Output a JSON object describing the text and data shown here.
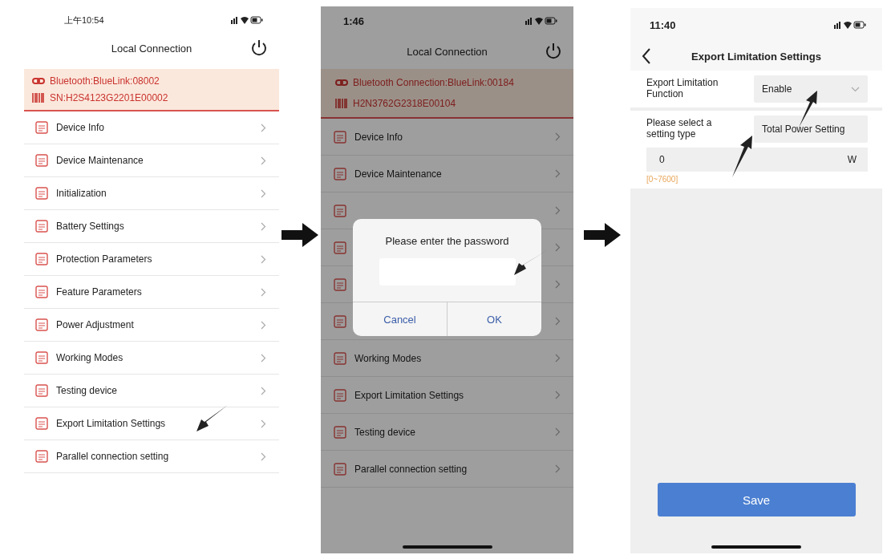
{
  "screens": [
    {
      "kind": "menu",
      "status_bar": {
        "time": "上午10:54"
      },
      "title": "Local Connection",
      "connection": {
        "bluetooth": "Bluetooth:BlueLink:08002",
        "serial": "SN:H2S4123G2201E00002"
      },
      "menu": [
        {
          "label": "Device Info"
        },
        {
          "label": "Device Maintenance"
        },
        {
          "label": "Initialization"
        },
        {
          "label": "Battery Settings"
        },
        {
          "label": "Protection Parameters"
        },
        {
          "label": "Feature Parameters"
        },
        {
          "label": "Power Adjustment"
        },
        {
          "label": "Working Modes"
        },
        {
          "label": "Testing device"
        },
        {
          "label": "Export Limitation Settings"
        },
        {
          "label": "Parallel connection setting"
        }
      ]
    },
    {
      "kind": "menu",
      "dimmed": true,
      "status_bar": {
        "time": "1:46"
      },
      "title": "Local Connection",
      "connection": {
        "bluetooth": "Bluetooth Connection:BlueLink:00184",
        "serial": "H2N3762G2318E00104"
      },
      "menu": [
        {
          "label": "Device Info",
          "covered": false
        },
        {
          "label": "Device Maintenance",
          "covered": false
        },
        {
          "covered": true
        },
        {
          "covered": true
        },
        {
          "covered": true
        },
        {
          "covered": true
        },
        {
          "label": "Working Modes",
          "covered": false
        },
        {
          "label": "Export Limitation Settings",
          "covered": false
        },
        {
          "label": "Testing device",
          "covered": false
        },
        {
          "label": "Parallel connection setting",
          "covered": false
        }
      ],
      "dialog": {
        "title": "Please enter the password",
        "buttons": [
          "Cancel",
          "OK"
        ]
      }
    },
    {
      "kind": "form",
      "status_bar": {
        "time": "11:40"
      },
      "title": "Export Limitation Settings",
      "fields": [
        {
          "kind": "select",
          "label": "Export Limitation Function",
          "value": "Enable"
        },
        {
          "kind": "choice",
          "label": "Please select a setting type",
          "value": "Total Power Setting"
        },
        {
          "kind": "number",
          "value": "0",
          "unit": "W",
          "hint": "[0~7600]"
        }
      ],
      "save_button": "Save"
    }
  ]
}
